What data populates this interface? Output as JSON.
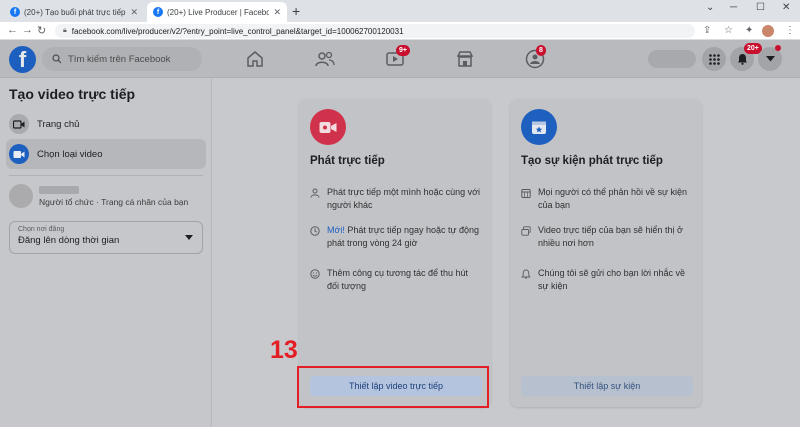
{
  "browser": {
    "tabs": [
      {
        "title": "(20+) Tạo buổi phát trực tiếp | Fa",
        "active": false
      },
      {
        "title": "(20+) Live Producer | Facebook",
        "active": true
      }
    ],
    "url": "facebook.com/live/producer/v2/?entry_point=live_control_panel&target_id=10006270012003​1"
  },
  "header": {
    "search_placeholder": "Tìm kiếm trên Facebook",
    "watch_badge": "9+",
    "groups_badge": "8",
    "notifications_badge": "20+"
  },
  "sidebar": {
    "title": "Tạo video trực tiếp",
    "items": [
      {
        "label": "Trang chủ",
        "icon": "video-camera-icon",
        "selected": false
      },
      {
        "label": "Chọn loại video",
        "icon": "video-camera-icon",
        "selected": true
      }
    ],
    "page_subtitle": "Người tổ chức · Trang cá nhân của bạn",
    "post_location": {
      "label": "Chọn nơi đăng",
      "value": "Đăng lên dòng thời gian"
    }
  },
  "cards": [
    {
      "title": "Phát trực tiếp",
      "icon": "live-video-icon",
      "features": [
        {
          "icon": "person-icon",
          "new_label": "",
          "text": "Phát trực tiếp một mình hoặc cùng với người khác"
        },
        {
          "icon": "clock-icon",
          "new_label": "Mới!",
          "text": " Phát trực tiếp ngay hoặc tự động phát trong vòng 24 giờ"
        },
        {
          "icon": "smiley-icon",
          "new_label": "",
          "text": "Thêm công cụ tương tác để thu hút đối tượng"
        }
      ],
      "button_label": "Thiết lập video trực tiếp"
    },
    {
      "title": "Tạo sự kiện phát trực tiếp",
      "icon": "calendar-star-icon",
      "features": [
        {
          "icon": "calendar-icon",
          "new_label": "",
          "text": "Mọi người có thể phản hồi về sự kiện của bạn"
        },
        {
          "icon": "video-stack-icon",
          "new_label": "",
          "text": "Video trực tiếp của bạn sẽ hiển thị ở nhiều nơi hơn"
        },
        {
          "icon": "bell-icon",
          "new_label": "",
          "text": "Chúng tôi sẽ gửi cho bạn lời nhắc về sự kiện"
        }
      ],
      "button_label": "Thiết lập sự kiện"
    }
  ],
  "annotation": {
    "step_number": "13",
    "color": "#e31e24"
  },
  "colors": {
    "facebook_blue": "#1877f2",
    "live_red": "#d0314b",
    "event_blue": "#1d60c0"
  }
}
